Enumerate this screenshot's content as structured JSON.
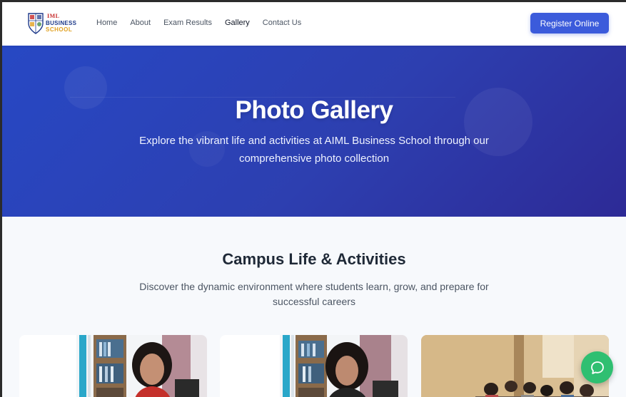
{
  "logo": {
    "line1": "IML",
    "line2": "BUSINESS",
    "line3": "SCHOOL"
  },
  "nav": {
    "items": [
      {
        "label": "Home",
        "active": false
      },
      {
        "label": "About",
        "active": false
      },
      {
        "label": "Exam Results",
        "active": false
      },
      {
        "label": "Gallery",
        "active": true
      },
      {
        "label": "Contact Us",
        "active": false
      }
    ],
    "register_label": "Register Online"
  },
  "hero": {
    "title": "Photo Gallery",
    "subtitle": "Explore the vibrant life and activities at AIML Business School through our comprehensive photo collection"
  },
  "section": {
    "title": "Campus Life & Activities",
    "subtitle": "Discover the dynamic environment where students learn, grow, and prepare for successful careers"
  },
  "gallery": {
    "items": [
      {
        "icon": "photo-student-office"
      },
      {
        "icon": "photo-student-office"
      },
      {
        "icon": "photo-classroom"
      }
    ]
  },
  "chat": {
    "icon": "chat-bubble-icon"
  },
  "colors": {
    "accent": "#3b5bdb",
    "hero_start": "#2748c4",
    "hero_end": "#2d2a96",
    "chat": "#2fbf71",
    "heading": "#1f2937"
  }
}
